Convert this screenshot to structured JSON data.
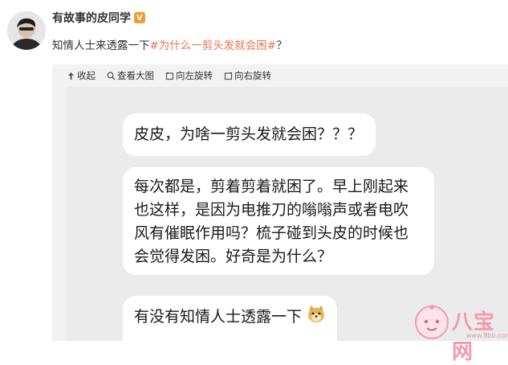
{
  "post": {
    "author": "有故事的皮同学",
    "text_prefix": "知情人士来透露一下",
    "topic": "#为什么一剪头发就会困#",
    "text_suffix": "？"
  },
  "toolbar": {
    "collapse_label": "收起",
    "view_large_label": "查看大图",
    "rotate_left_label": "向左旋转",
    "rotate_right_label": "向右旋转"
  },
  "image": {
    "bubble1": "皮皮，为啥一剪头发就会困？？？",
    "bubble2": "每次都是，剪着剪着就困了。早上刚起来也这样，是因为电推刀的嗡嗡声或者电吹风有催眠作用吗？梳子碰到头皮的时候也会觉得发困。好奇是为什么？",
    "bubble3": "有没有知情人士透露一下",
    "watermark_text": "八宝网",
    "watermark_url": "www.8bb.com"
  },
  "colors": {
    "topic": "#eb7350",
    "vip_badge": "#f39b2d",
    "watermark": "#f29aae"
  },
  "icons": [
    "avatar",
    "verified-badge-icon",
    "collapse-icon",
    "zoom-icon",
    "rotate-left-icon",
    "rotate-right-icon",
    "doge-emoji-icon",
    "watermark-mascot-icon"
  ]
}
